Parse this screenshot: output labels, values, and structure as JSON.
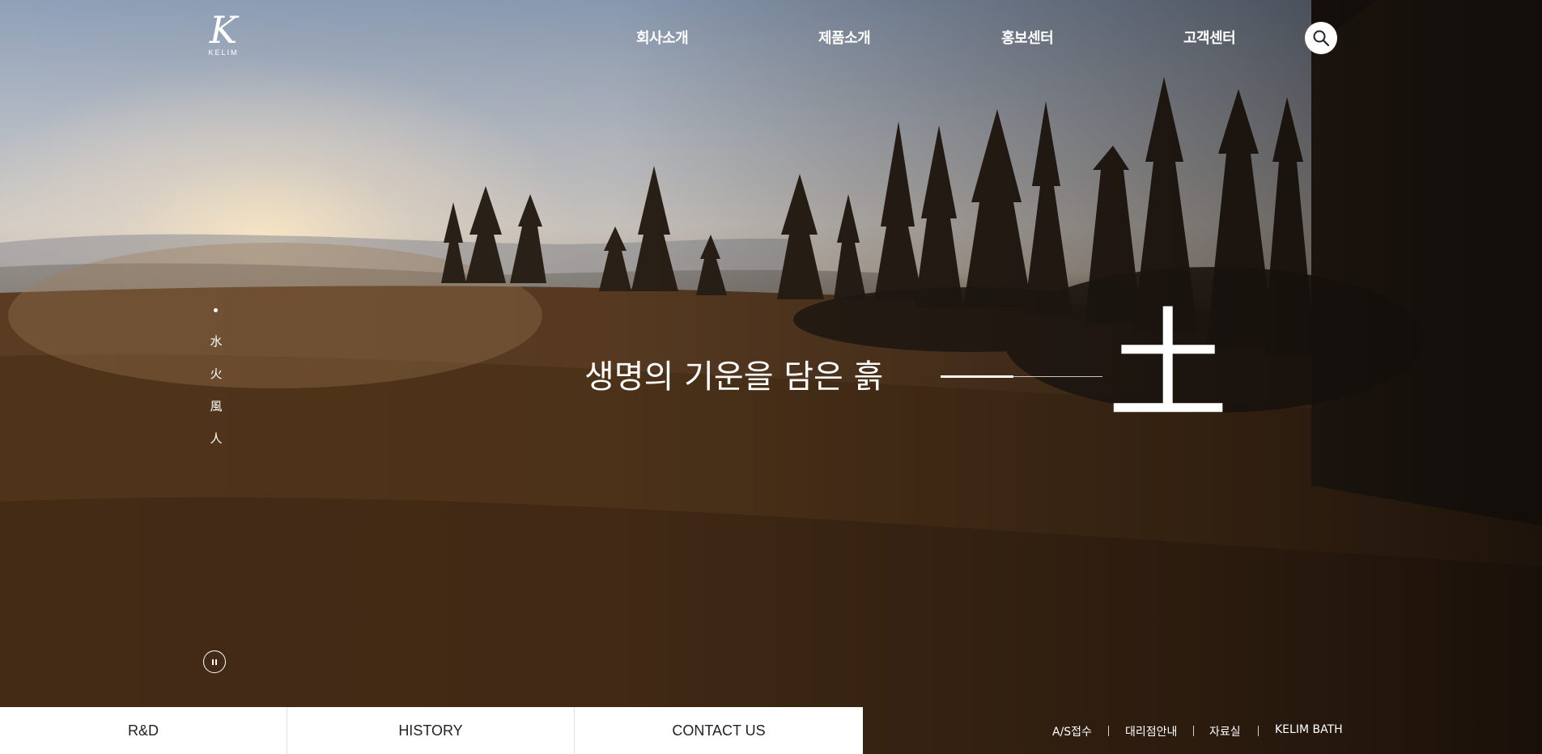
{
  "logo": {
    "mark": "K",
    "text": "KELIM"
  },
  "nav": {
    "items": [
      {
        "label": "회사소개"
      },
      {
        "label": "제품소개"
      },
      {
        "label": "홍보센터"
      },
      {
        "label": "고객센터"
      }
    ],
    "search_icon": "search-icon"
  },
  "side_nav": {
    "items": [
      {
        "label": "水"
      },
      {
        "label": "火"
      },
      {
        "label": "風"
      },
      {
        "label": "人"
      }
    ],
    "pause_icon": "pause-icon"
  },
  "hero": {
    "headline": "생명의 기운을 담은 흙",
    "element_char": "土",
    "progress": 0.45
  },
  "quick_links": [
    {
      "label": "R&D"
    },
    {
      "label": "HISTORY"
    },
    {
      "label": "CONTACT US"
    }
  ],
  "footer_links": [
    {
      "label": "A/S접수"
    },
    {
      "label": "대리점안내"
    },
    {
      "label": "자료실"
    },
    {
      "label": "KELIM BATH"
    }
  ],
  "colors": {
    "text": "#ffffff",
    "quick_link_bg": "#ffffff",
    "quick_link_text": "#222222"
  }
}
